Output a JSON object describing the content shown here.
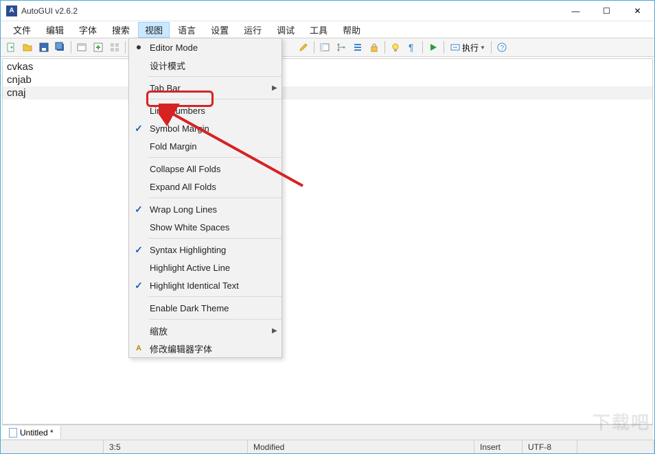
{
  "window": {
    "title": "AutoGUI v2.6.2"
  },
  "menubar": [
    "文件",
    "编辑",
    "字体",
    "搜索",
    "视图",
    "语言",
    "设置",
    "运行",
    "调试",
    "工具",
    "帮助"
  ],
  "menubar_active_index": 4,
  "toolbar_run_label": "执行",
  "dropdown": {
    "editor_mode": "Editor Mode",
    "design_mode": "设计模式",
    "tab_bar": "Tab Bar",
    "line_numbers": "Line Numbers",
    "symbol_margin": "Symbol Margin",
    "fold_margin": "Fold Margin",
    "collapse_all": "Collapse All Folds",
    "expand_all": "Expand All Folds",
    "wrap_long": "Wrap Long Lines",
    "show_ws": "Show White Spaces",
    "syntax_hl": "Syntax Highlighting",
    "hl_active": "Highlight Active Line",
    "hl_identical": "Highlight Identical Text",
    "dark_theme": "Enable Dark Theme",
    "zoom": "缩放",
    "editor_font": "修改编辑器字体"
  },
  "editor": {
    "line1": "cvkas",
    "line2": "cnjab",
    "line3": "cnaj"
  },
  "tab": {
    "name": "Untitled *"
  },
  "statusbar": {
    "pos": "3:5",
    "modified": "Modified",
    "insert": "Insert",
    "encoding": "UTF-8"
  },
  "watermark": "下载吧"
}
